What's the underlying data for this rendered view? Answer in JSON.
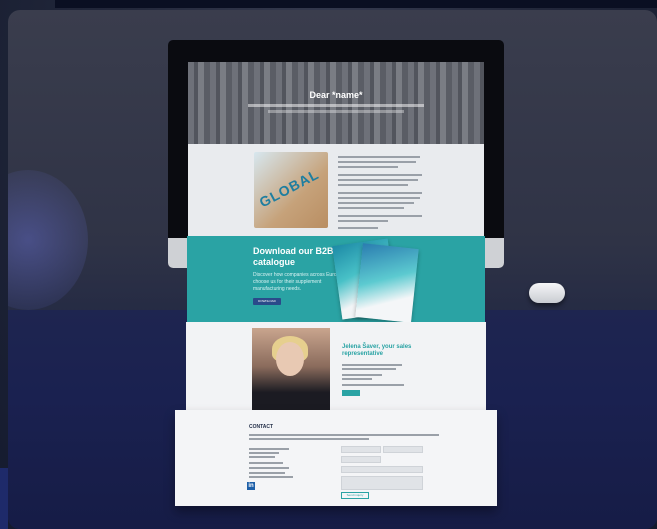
{
  "hero": {
    "title": "Dear *name*"
  },
  "box_logo": "GLOBAL",
  "download": {
    "title": "Download our B2B catalogue",
    "subtitle": "Discover how companies across Europe choose us for their supplement manufacturing needs.",
    "button": "DOWNLOAD"
  },
  "rep": {
    "title": "Jelena Šaver, your sales representative"
  },
  "contact": {
    "title": "CONTACT",
    "send_button": "Send inquiry"
  },
  "social": {
    "linkedin": "in"
  },
  "colors": {
    "teal": "#2aa3a4",
    "navy_bg": "#1c2350",
    "button_blue": "#2a4a8a"
  }
}
